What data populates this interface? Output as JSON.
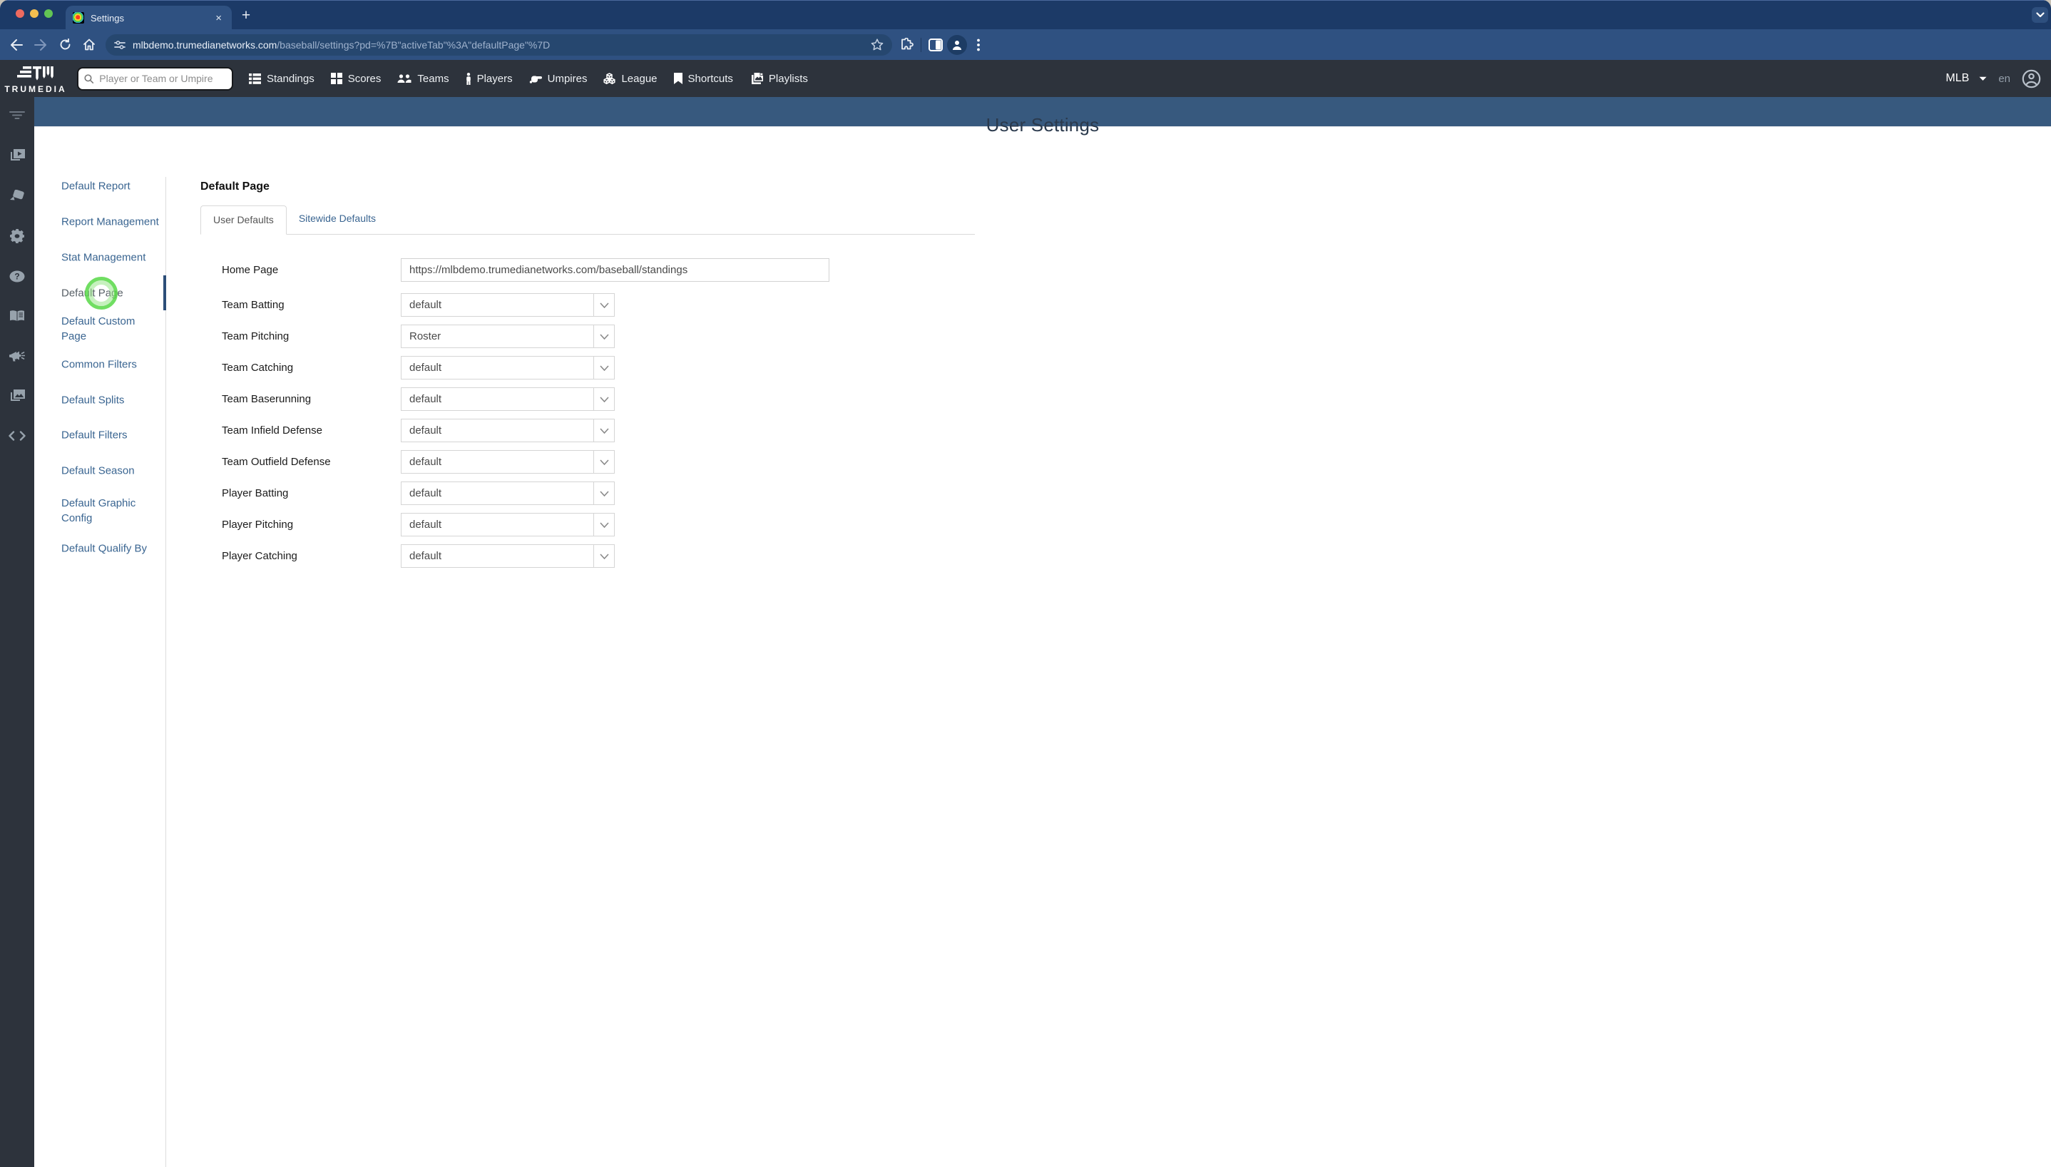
{
  "window": {
    "tab_title": "Settings",
    "close_glyph": "×",
    "new_tab_glyph": "+",
    "url_host": "mlbdemo.trumedianetworks.com",
    "url_path": "/baseball/settings?pd=%7B\"activeTab\"%3A\"defaultPage\"%7D"
  },
  "nav": {
    "brand": "TRUMEDIA",
    "search_placeholder": "Player or Team or Umpire",
    "items": [
      {
        "icon": "standings-icon",
        "label": "Standings"
      },
      {
        "icon": "scores-icon",
        "label": "Scores"
      },
      {
        "icon": "teams-icon",
        "label": "Teams"
      },
      {
        "icon": "players-icon",
        "label": "Players"
      },
      {
        "icon": "umpires-icon",
        "label": "Umpires"
      },
      {
        "icon": "league-icon",
        "label": "League"
      },
      {
        "icon": "shortcuts-icon",
        "label": "Shortcuts"
      },
      {
        "icon": "playlists-icon",
        "label": "Playlists"
      }
    ],
    "league": "MLB",
    "locale": "en"
  },
  "rail": {
    "icons": [
      "filter-icon",
      "video-library-icon",
      "tag-icon",
      "gear-icon",
      "help-icon",
      "book-icon",
      "megaphone-icon",
      "gallery-icon",
      "code-icon"
    ]
  },
  "settings_menu": {
    "items": [
      {
        "label": "Default Report",
        "active": false
      },
      {
        "label": "Report Management",
        "active": false
      },
      {
        "label": "Stat Management",
        "active": false
      },
      {
        "label": "Default Page",
        "active": true
      },
      {
        "label": "Default Custom Page",
        "active": false
      },
      {
        "label": "Common Filters",
        "active": false
      },
      {
        "label": "Default Splits",
        "active": false
      },
      {
        "label": "Default Filters",
        "active": false
      },
      {
        "label": "Default Season",
        "active": false
      },
      {
        "label": "Default Graphic Config",
        "active": false
      },
      {
        "label": "Default Qualify By",
        "active": false
      }
    ]
  },
  "main": {
    "page_title": "User Settings",
    "section_title": "Default Page",
    "tabs": [
      {
        "label": "User Defaults",
        "active": true
      },
      {
        "label": "Sitewide Defaults",
        "active": false
      }
    ],
    "form": {
      "rows": [
        {
          "label": "Home Page",
          "type": "text",
          "value": "https://mlbdemo.trumedianetworks.com/baseball/standings"
        },
        {
          "label": "Team Batting",
          "type": "select",
          "value": "default"
        },
        {
          "label": "Team Pitching",
          "type": "select",
          "value": "Roster"
        },
        {
          "label": "Team Catching",
          "type": "select",
          "value": "default"
        },
        {
          "label": "Team Baserunning",
          "type": "select",
          "value": "default"
        },
        {
          "label": "Team Infield Defense",
          "type": "select",
          "value": "default"
        },
        {
          "label": "Team Outfield Defense",
          "type": "select",
          "value": "default"
        },
        {
          "label": "Player Batting",
          "type": "select",
          "value": "default"
        },
        {
          "label": "Player Pitching",
          "type": "select",
          "value": "default"
        },
        {
          "label": "Player Catching",
          "type": "select",
          "value": "default"
        }
      ]
    }
  },
  "colors": {
    "chrome_tabstrip": "#1c3a67",
    "chrome_toolbar": "#2f5181",
    "app_nav": "#2d333c",
    "hero_band": "#37597e",
    "link_blue": "#3a6591",
    "active_item_gray": "#575f66",
    "click_highlight_green": "#57d847"
  }
}
